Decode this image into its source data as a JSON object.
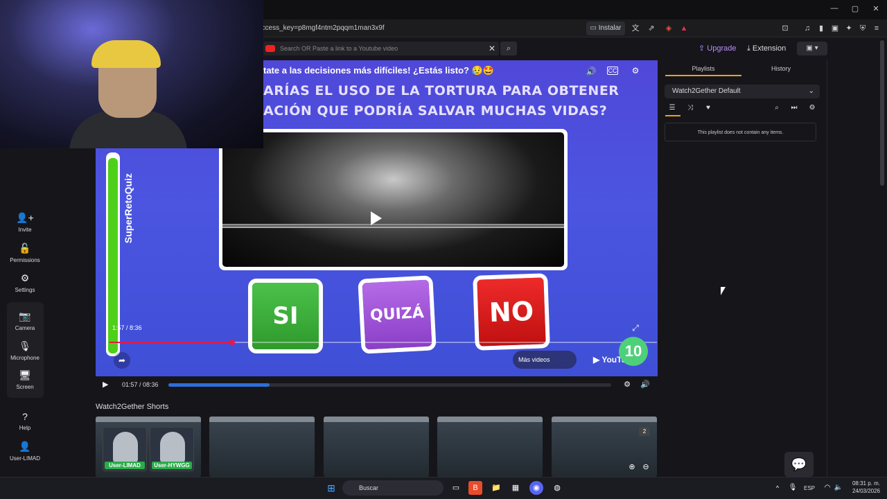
{
  "browser": {
    "url": "access_key=p8mgf4ntm2pqqm1man3x9f",
    "install_label": "Instalar",
    "window_controls": [
      "—",
      "▢",
      "✕"
    ]
  },
  "header": {
    "search_placeholder": "Search OR Paste a link to a Youtube video",
    "upgrade_label": "Upgrade",
    "extension_label": "Extension",
    "theme_label": "▣ ▾"
  },
  "sidebar": {
    "items": [
      {
        "label": "Invite",
        "icon": "add-user-icon"
      },
      {
        "label": "Permissions",
        "icon": "lock-icon"
      },
      {
        "label": "Settings",
        "icon": "gear-icon"
      },
      {
        "label": "Camera",
        "icon": "camera-icon"
      },
      {
        "label": "Microphone",
        "icon": "microphone-icon"
      },
      {
        "label": "Screen",
        "icon": "screen-icon"
      },
      {
        "label": "Help",
        "icon": "help-icon"
      },
      {
        "label": "User-LIMAD",
        "icon": "user-icon"
      }
    ]
  },
  "video": {
    "title": "tate a las decisiones más difíciles! ¿Estás listo? 😥🤩",
    "question_line1": "ARÍAS EL USO DE LA TORTURA PARA OBTENER",
    "question_line2": "ACIÓN QUE PODRÍA SALVAR MUCHAS VIDAS?",
    "brand": "SuperRetoQuiz",
    "answers": [
      "SI",
      "QUIZÁ",
      "NO"
    ],
    "overlay_time": "1:57 / 8:36",
    "counter": "10",
    "more_videos": "Más videos",
    "youtube_label": "YouTube",
    "overlay_progress": 0.22
  },
  "player": {
    "time": "01:57 / 08:36",
    "progress": 0.228
  },
  "shorts": {
    "title": "Watch2Gether Shorts",
    "badge": "2"
  },
  "users": [
    {
      "name": "User-LIMAD"
    },
    {
      "name": "User-HYWGG"
    }
  ],
  "right_panel": {
    "tabs": [
      "Playlists",
      "History"
    ],
    "active_tab": "Playlists",
    "playlist_name": "Watch2Gether Default",
    "empty_message": "This playlist does not contain any items."
  },
  "taskbar": {
    "search_label": "Buscar",
    "lang": "ESP",
    "time": "08:31 p. m.",
    "date": "24/03/2026"
  },
  "colors": {
    "accent": "#f0a020",
    "video_bg": "#4b55e0",
    "progress": "#2d6fd8",
    "upgrade": "#b88cff"
  }
}
